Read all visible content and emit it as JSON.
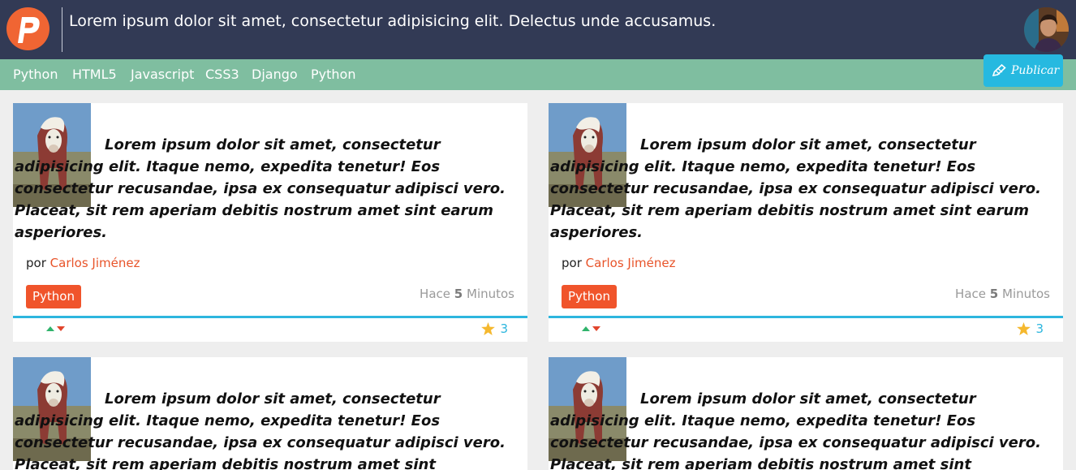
{
  "header": {
    "title": "Lorem ipsum dolor sit amet, consectetur adipisicing elit. Delectus unde accusamus.",
    "logo_icon": "logo-p-icon",
    "avatar_icon": "user-avatar"
  },
  "nav": {
    "items": [
      "Python",
      "HTML5",
      "Javascript",
      "CSS3",
      "Django",
      "Python"
    ],
    "publish_label": "Publicar"
  },
  "colors": {
    "header_bg": "#323a55",
    "nav_bg": "#7fbea0",
    "accent": "#2db6de",
    "brand": "#f06533",
    "tag": "#f0542b"
  },
  "posts": [
    {
      "text": "Lorem ipsum dolor sit amet, consectetur adipisicing elit. Itaque nemo, expedita tenetur! Eos consectetur recusandae, ipsa ex consequatur adipisci vero. Placeat, sit rem aperiam debitis nostrum amet sint earum asperiores.",
      "by": "por",
      "author": "Carlos Jiménez",
      "tag": "Python",
      "time_prefix": "Hace",
      "time_value": "5",
      "time_unit": "Minutos",
      "stars": "3"
    },
    {
      "text": "Lorem ipsum dolor sit amet, consectetur adipisicing elit. Itaque nemo, expedita tenetur! Eos consectetur recusandae, ipsa ex consequatur adipisci vero. Placeat, sit rem aperiam debitis nostrum amet sint earum asperiores.",
      "by": "por",
      "author": "Carlos Jiménez",
      "tag": "Python",
      "time_prefix": "Hace",
      "time_value": "5",
      "time_unit": "Minutos",
      "stars": "3"
    },
    {
      "text": "Lorem ipsum dolor sit amet, consectetur adipisicing elit. Itaque nemo, expedita tenetur! Eos consectetur recusandae, ipsa ex consequatur adipisci vero. Placeat, sit rem aperiam debitis nostrum amet sint"
    },
    {
      "text": "Lorem ipsum dolor sit amet, consectetur adipisicing elit. Itaque nemo, expedita tenetur! Eos consectetur recusandae, ipsa ex consequatur adipisci vero. Placeat, sit rem aperiam debitis nostrum amet sint"
    }
  ]
}
